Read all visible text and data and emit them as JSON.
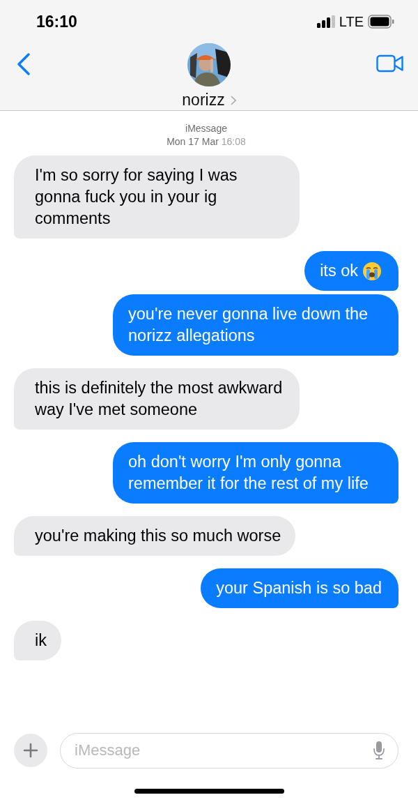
{
  "status_bar": {
    "time": "16:10",
    "network": "LTE"
  },
  "header": {
    "contact_name": "norizz"
  },
  "thread_info": {
    "service": "iMessage",
    "date": "Mon 17 Mar",
    "time": "16:08"
  },
  "messages": [
    {
      "kind": "received",
      "text": "I'm so sorry for saying I was gonna fuck you in your ig comments"
    },
    {
      "kind": "sent",
      "text": "its ok",
      "trailing_emoji": true
    },
    {
      "kind": "sent",
      "text": "you're never gonna live down the norizz allegations"
    },
    {
      "kind": "received",
      "text": "this is definitely the most awkward way I've met someone"
    },
    {
      "kind": "sent",
      "text": "oh don't worry I'm only gonna remember it for the rest of my life"
    },
    {
      "kind": "received",
      "text": "you're making this so much worse"
    },
    {
      "kind": "sent",
      "text": "your Spanish is so bad"
    },
    {
      "kind": "received",
      "text": "ik"
    }
  ],
  "composer": {
    "placeholder": "iMessage"
  }
}
